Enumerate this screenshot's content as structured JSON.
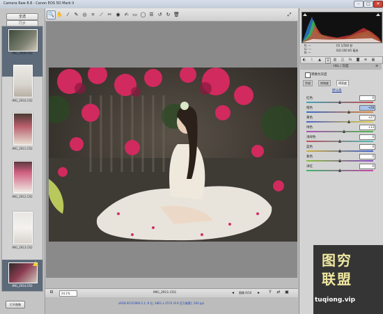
{
  "window": {
    "title": "Camera Raw 8.8  -  Canon EOS 5D Mark II",
    "min": "–",
    "max": "□",
    "close": "✕"
  },
  "left": {
    "select_all": "全选",
    "sync": "同步",
    "thumbnails": [
      {
        "caption": "IMG_2909.CR2",
        "selected": true,
        "warn": true
      },
      {
        "caption": "IMG_2910.CR2"
      },
      {
        "caption": "IMG_2911.CR2"
      },
      {
        "caption": "IMG_2912.CR2"
      },
      {
        "caption": "IMG_2913.CR2"
      },
      {
        "caption": "IMG_2914.CR2"
      }
    ],
    "open_images": "打开图像"
  },
  "bottombar": {
    "zoom": "24.1%",
    "filename": "IMG_2911.CR2",
    "count": "图像 6/10"
  },
  "infoline": "sRGB IEC61966-2.1; 8 位; 3861 x 2574 (9.9 百万像素); 300 ppi",
  "readout": {
    "line1": "f/2    1/500 秒",
    "line2": "ISO 200  85 毫米"
  },
  "panel": {
    "header": "HSL / 灰度",
    "convert_label": "转换为灰度",
    "subtabs": [
      "色相",
      "饱和度",
      "明亮度"
    ],
    "active_subtab": 2,
    "default_link": "默认值",
    "sliders": [
      {
        "label": "红色",
        "value": "0",
        "pos": 0.5,
        "colors": [
          "#3ea5b5",
          "#c8484b"
        ]
      },
      {
        "label": "橙色",
        "value": "+28",
        "pos": 0.64,
        "colors": [
          "#3a6ac6",
          "#e08438"
        ],
        "highlight": true
      },
      {
        "label": "黄色",
        "value": "+27",
        "pos": 0.64,
        "colors": [
          "#4f5fc9",
          "#e3d13a"
        ]
      },
      {
        "label": "绿色",
        "value": "+13",
        "pos": 0.56,
        "colors": [
          "#b04fb8",
          "#4cb84c"
        ]
      },
      {
        "label": "浅绿色",
        "value": "0",
        "pos": 0.5,
        "colors": [
          "#c04f5a",
          "#4cbcb8"
        ]
      },
      {
        "label": "蓝色",
        "value": "0",
        "pos": 0.5,
        "colors": [
          "#d0b03a",
          "#3a5bd0"
        ]
      },
      {
        "label": "紫色",
        "value": "0",
        "pos": 0.5,
        "colors": [
          "#8bbf3a",
          "#8a48c8"
        ]
      },
      {
        "label": "洋红",
        "value": "0",
        "pos": 0.5,
        "colors": [
          "#3fb56a",
          "#c843a8"
        ]
      }
    ]
  },
  "watermark": {
    "line1": "图穷",
    "line2": "联盟",
    "url": "tuqiong.vip"
  },
  "colors": {
    "accent": "#1d3fa8",
    "watermark_text": "#f0e8a0"
  }
}
